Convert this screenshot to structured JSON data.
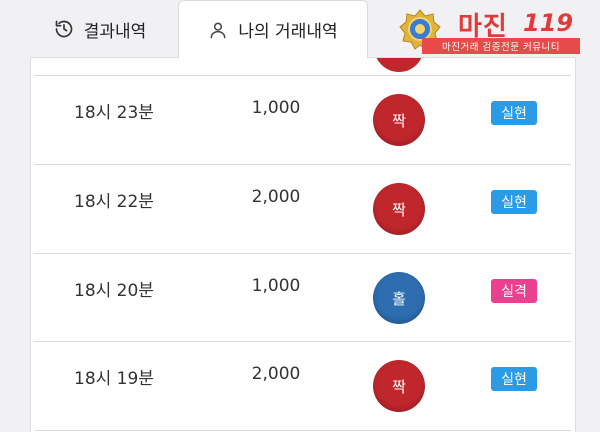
{
  "tabs": [
    {
      "label": "결과내역",
      "icon": "history-icon",
      "active": false
    },
    {
      "label": "나의 거래내역",
      "icon": "user-icon",
      "active": true
    }
  ],
  "logo": {
    "word": "마진",
    "number": "119",
    "tagline": "마진거래 검증전문 커뮤니티"
  },
  "colors": {
    "even_ball": "#c0272d",
    "odd_ball": "#2e6db0",
    "success_badge": "#2b9be6",
    "fail_badge": "#ec3f8f",
    "logo_red": "#e23a3a"
  },
  "trades": [
    {
      "time": "18시 23분",
      "amount": "1,000",
      "pick": "짝",
      "pick_type": "even",
      "result": "실현",
      "result_type": "success"
    },
    {
      "time": "18시 22분",
      "amount": "2,000",
      "pick": "짝",
      "pick_type": "even",
      "result": "실현",
      "result_type": "success"
    },
    {
      "time": "18시 20분",
      "amount": "1,000",
      "pick": "홀",
      "pick_type": "odd",
      "result": "실격",
      "result_type": "fail"
    },
    {
      "time": "18시 19분",
      "amount": "2,000",
      "pick": "짝",
      "pick_type": "even",
      "result": "실현",
      "result_type": "success"
    }
  ]
}
